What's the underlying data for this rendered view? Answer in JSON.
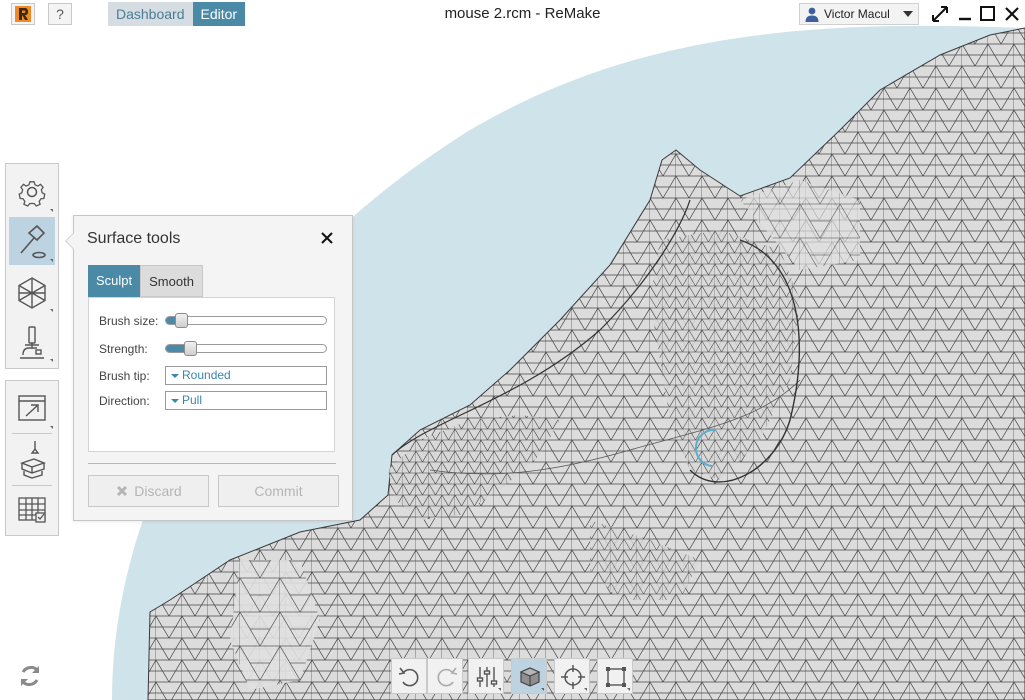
{
  "header": {
    "title": "mouse 2.rcm - ReMake",
    "help_label": "?",
    "tabs": [
      {
        "label": "Dashboard",
        "active": false
      },
      {
        "label": "Editor",
        "active": true
      }
    ],
    "user_name": "Victor Macul"
  },
  "left_toolbar": {
    "items": [
      {
        "icon": "gear-icon"
      },
      {
        "icon": "hammer-icon",
        "selected": true
      },
      {
        "icon": "hexagon-mesh-icon"
      },
      {
        "icon": "microscope-icon"
      },
      {
        "icon": "export-window-icon"
      },
      {
        "icon": "3d-print-icon"
      },
      {
        "icon": "grid-table-icon"
      }
    ]
  },
  "surface_tools": {
    "title": "Surface tools",
    "tabs": [
      {
        "label": "Sculpt",
        "active": true
      },
      {
        "label": "Smooth",
        "active": false
      }
    ],
    "brush_size_label": "Brush size:",
    "brush_size_value": 0.06,
    "strength_label": "Strength:",
    "strength_value": 0.12,
    "brush_tip_label": "Brush tip:",
    "brush_tip_value": "Rounded",
    "direction_label": "Direction:",
    "direction_value": "Pull",
    "discard_label": "Discard",
    "commit_label": "Commit"
  },
  "bottom_toolbar": {
    "items": [
      "undo-icon",
      "redo-icon",
      "sliders-icon",
      "cube-view-icon",
      "crosshair-icon",
      "frame-icon"
    ],
    "selected": "cube-view-icon"
  },
  "colors": {
    "accent": "#4a8aa6",
    "background_ellipse": "#cfe3ea",
    "mesh_fill": "#dcdcdc",
    "mesh_line": "#404040",
    "brush_cursor": "#5aaecb"
  }
}
